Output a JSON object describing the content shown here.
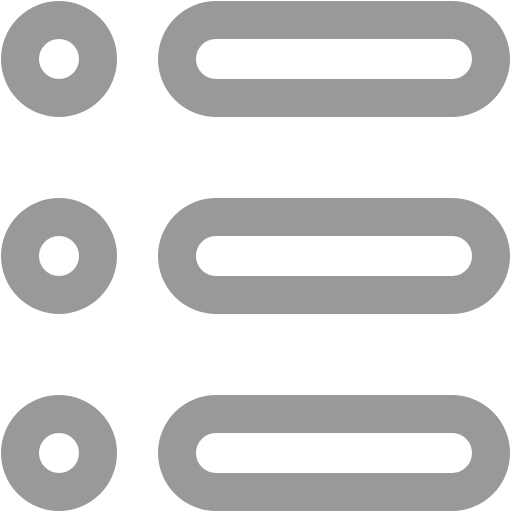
{
  "icon": {
    "name": "list-icon",
    "color": "#999999",
    "background": "#ffffff",
    "items": [
      {
        "bullet_icon": "circle-bullet-icon",
        "bar_icon": "rounded-bar-icon"
      },
      {
        "bullet_icon": "circle-bullet-icon",
        "bar_icon": "rounded-bar-icon"
      },
      {
        "bullet_icon": "circle-bullet-icon",
        "bar_icon": "rounded-bar-icon"
      }
    ]
  }
}
